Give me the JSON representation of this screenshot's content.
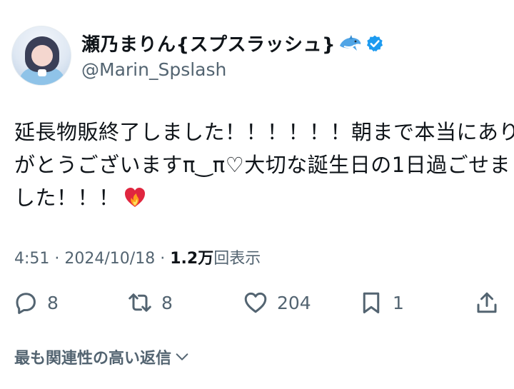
{
  "author": {
    "display_name": "瀬乃まりん{スプスラッシュ}",
    "handle": "@Marin_Spslash",
    "avatar": "avatar-photo",
    "name_emoji": "dolphin-icon",
    "badge": "verified-badge-icon"
  },
  "tweet": {
    "lines": [
      "延長物販終了しました！！！！！！朝まで本当にあり",
      "がとうございますπ‿π♡大切な誕生日の1日過ごせま",
      "した！！！"
    ],
    "trailing_emoji": "heart-on-fire-icon"
  },
  "meta": {
    "time": "4:51",
    "separator": "·",
    "date": "2024/10/18",
    "views_count": "1.2万",
    "views_label": "回表示"
  },
  "actions": {
    "replies": "8",
    "reposts": "8",
    "likes": "204",
    "bookmarks": "1"
  },
  "related": {
    "label": "最も関連性の高い返信"
  },
  "colors": {
    "text": "#0f1419",
    "secondary": "#536471",
    "verified": "#1d9bf0"
  }
}
